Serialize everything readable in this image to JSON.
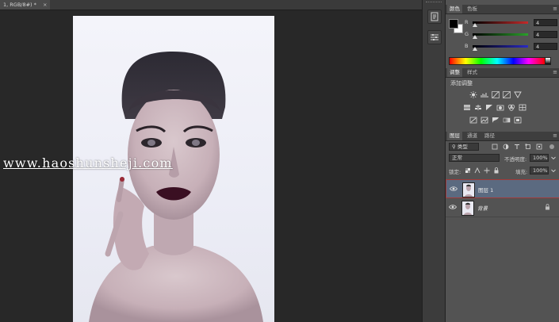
{
  "document": {
    "tab_title": "1, RGB/8#) *",
    "close_glyph": "×"
  },
  "watermark": {
    "text": "www.haoshunsheji.com"
  },
  "toolstrip": {
    "buttons": [
      "history-icon",
      "properties-icon"
    ]
  },
  "color_panel": {
    "tabs": [
      "颜色",
      "色板"
    ],
    "foreground": "#000000",
    "background": "#ffffff",
    "channels": [
      {
        "label": "R",
        "value": "4",
        "track_color": "#c42a2a"
      },
      {
        "label": "G",
        "value": "4",
        "track_color": "#2aa02a"
      },
      {
        "label": "B",
        "value": "4",
        "track_color": "#2a2ac4"
      }
    ]
  },
  "adjustments_panel": {
    "tabs": [
      "调整",
      "样式"
    ],
    "title": "添加调整",
    "icons_row1": [
      "brightness-icon",
      "levels-icon",
      "curves-icon",
      "exposure-icon",
      "vibrance-icon"
    ],
    "icons_row2": [
      "hue-saturation-icon",
      "color-balance-icon",
      "black-white-icon",
      "photo-filter-icon",
      "channel-mixer-icon",
      "color-lookup-icon"
    ],
    "icons_row3": [
      "invert-icon",
      "posterize-icon",
      "threshold-icon",
      "gradient-map-icon",
      "selective-color-icon"
    ]
  },
  "layers_panel": {
    "tabs": [
      "图层",
      "通道",
      "路径"
    ],
    "filter_kind": "类型",
    "blend_mode": "正常",
    "opacity_label": "不透明度:",
    "opacity_value": "100%",
    "lock_label": "锁定:",
    "fill_label": "填充:",
    "fill_value": "100%",
    "layers": [
      {
        "name": "图层 1",
        "selected": true,
        "locked": false
      },
      {
        "name": "背景",
        "selected": false,
        "locked": true
      }
    ]
  },
  "colors": {
    "accent_selection": "#5b6a80",
    "selection_border": "#a23a3a",
    "panel_bg": "#535353",
    "canvas_bg": "#282828"
  }
}
